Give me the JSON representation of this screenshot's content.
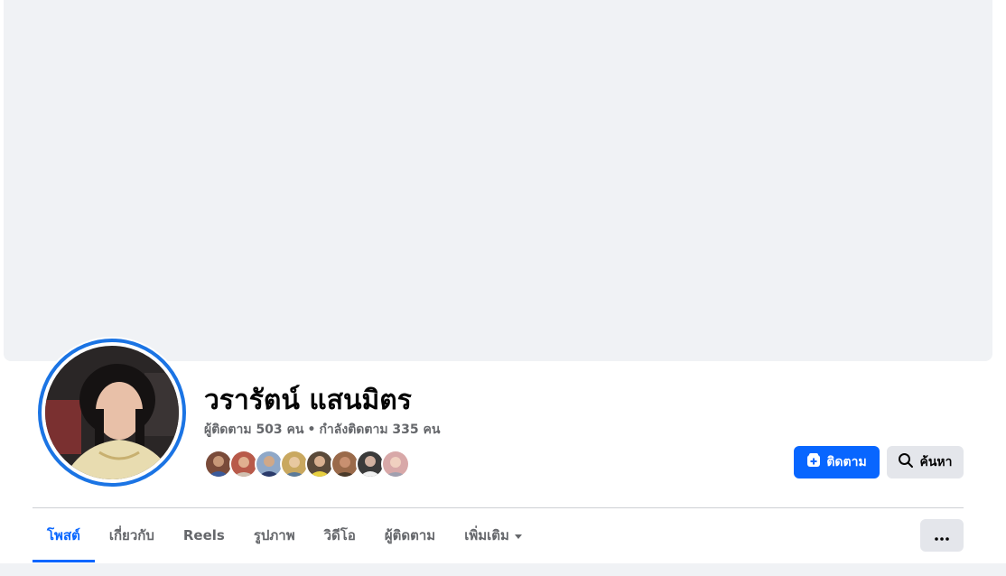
{
  "profile": {
    "name": "วรารัตน์ แสนมิตร",
    "followers_text": "ผู้ติดตาม 503 คน",
    "separator": "•",
    "following_text": "กำลังติดตาม 335 คน",
    "avatar_icon": "profile-photo",
    "friend_avatars": [
      {
        "icon": "friend-avatar",
        "color": "#7a4b3a"
      },
      {
        "icon": "friend-avatar",
        "color": "#b85a4a"
      },
      {
        "icon": "friend-avatar",
        "color": "#8fa8c8"
      },
      {
        "icon": "friend-avatar",
        "color": "#c9a860"
      },
      {
        "icon": "friend-avatar",
        "color": "#5a4a3a"
      },
      {
        "icon": "friend-avatar",
        "color": "#9a6a4a"
      },
      {
        "icon": "friend-avatar",
        "color": "#3a3a3a"
      },
      {
        "icon": "friend-avatar",
        "color": "#d8a8a8"
      }
    ]
  },
  "actions": {
    "follow_label": "ติดตาม",
    "follow_icon": "follow-icon",
    "search_label": "ค้นหา",
    "search_icon": "search-icon",
    "more_icon": "ellipsis-icon"
  },
  "tabs": [
    {
      "label": "โพสต์",
      "active": true
    },
    {
      "label": "เกี่ยวกับ",
      "active": false
    },
    {
      "label": "Reels",
      "active": false
    },
    {
      "label": "รูปภาพ",
      "active": false
    },
    {
      "label": "วิดีโอ",
      "active": false
    },
    {
      "label": "ผู้ติดตาม",
      "active": false
    },
    {
      "label": "เพิ่มเติม",
      "active": false,
      "has_caret": true
    }
  ],
  "colors": {
    "accent": "#0866ff",
    "avatar_ring": "#1b74e4",
    "cover_bg": "#f0f2f5",
    "secondary_text": "#65676b",
    "button_gray": "#e4e6eb"
  }
}
